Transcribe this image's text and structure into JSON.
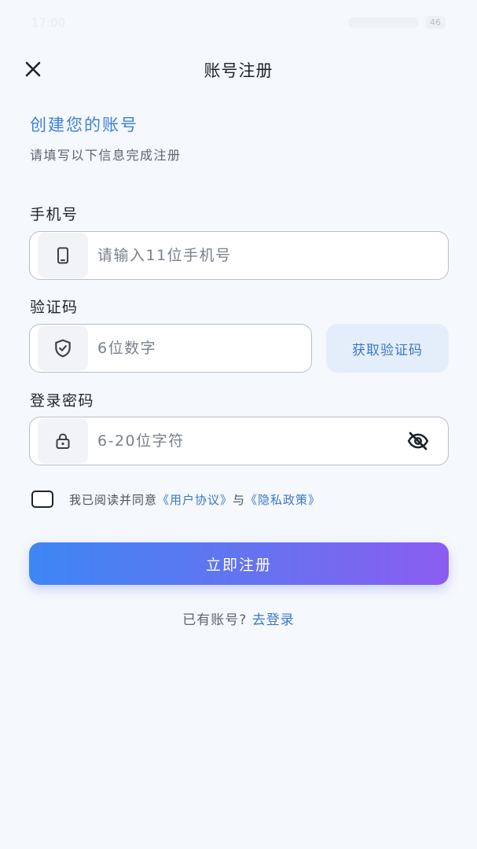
{
  "status_bar": {
    "time": "17:00",
    "battery": "46"
  },
  "header": {
    "title": "账号注册"
  },
  "intro": {
    "title": "创建您的账号",
    "subtitle": "请填写以下信息完成注册"
  },
  "phone": {
    "label": "手机号",
    "placeholder": "请输入11位手机号",
    "icon": "phone-icon"
  },
  "code": {
    "label": "验证码",
    "placeholder": "6位数字",
    "icon": "shield-check-icon",
    "button_label": "获取验证码"
  },
  "password": {
    "label": "登录密码",
    "placeholder": "6-20位字符",
    "icon": "lock-icon",
    "toggle_icon": "eye-off-icon"
  },
  "agreement": {
    "prefix": "我已阅读并同意",
    "user_agreement": "《用户协议》",
    "connector": "与",
    "privacy_policy": "《隐私政策》"
  },
  "submit": {
    "label": "立即注册"
  },
  "login": {
    "prompt": "已有账号?",
    "link": "去登录"
  },
  "colors": {
    "accent": "#3a78c8",
    "gradient_start": "#3d86f4",
    "gradient_end": "#8b5cf0",
    "background": "#f5f8fc"
  }
}
